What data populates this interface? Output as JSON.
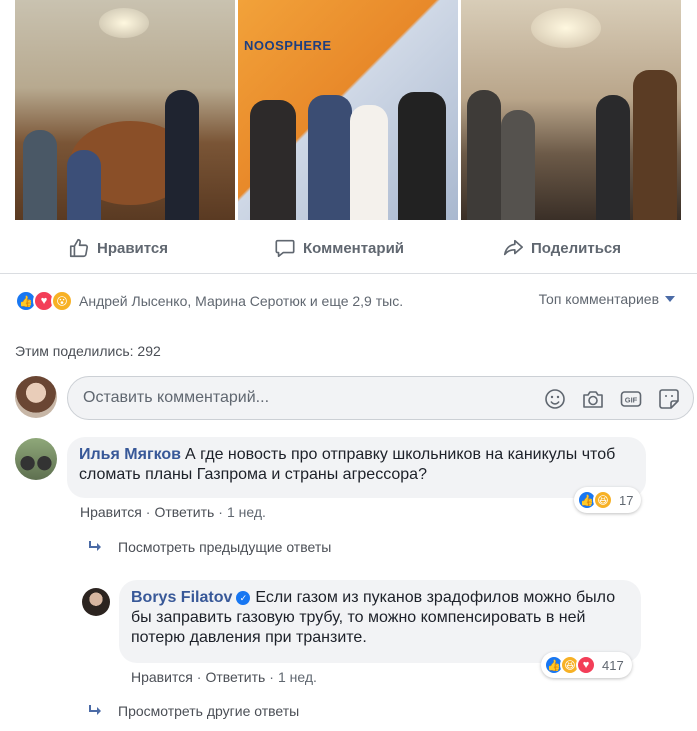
{
  "post": {
    "photos": [
      {
        "name": "meeting-room-photo"
      },
      {
        "name": "noosphere-group-photo",
        "sign": "NOOSPHERE"
      },
      {
        "name": "dinner-table-photo"
      }
    ],
    "actions": {
      "like": "Нравится",
      "comment": "Комментарий",
      "share": "Поделиться"
    },
    "reactions": {
      "icons": [
        "like-icon",
        "love-icon",
        "wow-icon"
      ],
      "summary": "Андрей Лысенко, Марина Серотюк и еще 2,9 тыс.",
      "sort_label": "Топ комментариев"
    },
    "shares": "Этим поделились: 292"
  },
  "composer": {
    "placeholder": "Оставить комментарий...",
    "icons": [
      "emoji-icon",
      "camera-icon",
      "gif-icon",
      "sticker-icon"
    ]
  },
  "comments": [
    {
      "author": "Илья Мягков",
      "text": "А где новость про отправку школьников на каникулы чтоб сломать планы Газпрома и страны агрессора?",
      "like_label": "Нравится",
      "reply_label": "Ответить",
      "time": "1 нед.",
      "reaction_count": "17",
      "reaction_icons": [
        "like-icon",
        "haha-icon"
      ]
    }
  ],
  "view_previous": "Посмотреть предыдущие ответы",
  "reply": {
    "author": "Borys Filatov",
    "verified": true,
    "text": "Если газом из пуканов зрадофилов можно было бы заправить газовую трубу, то можно компенсировать в ней потерю давления при транзите.",
    "like_label": "Нравится",
    "reply_label": "Ответить",
    "time": "1 нед.",
    "reaction_count": "417",
    "reaction_icons": [
      "like-icon",
      "haha-icon",
      "love-icon"
    ]
  },
  "view_other": "Просмотреть другие ответы",
  "colors": {
    "link_blue": "#385898",
    "like_blue": "#1877f2",
    "love_red": "#f33e58",
    "haha_yellow": "#f7b125",
    "muted_text": "#606770"
  }
}
